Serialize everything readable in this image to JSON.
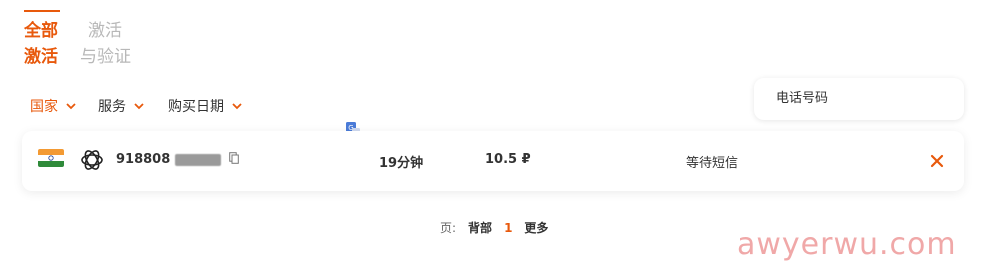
{
  "tabs": [
    {
      "label_line1": "全部",
      "label_line2": "激活",
      "active": true
    },
    {
      "label_line1": "激活",
      "label_line2": "与验证",
      "active": false
    }
  ],
  "filters": {
    "country": "国家",
    "service": "服务",
    "date": "购买日期"
  },
  "search": {
    "placeholder": "电话号码"
  },
  "rows": [
    {
      "flag": "india-flag",
      "service_icon": "openai-icon",
      "phone": "918808",
      "time": "19分钟",
      "price": "10.5 ₽",
      "status": "等待短信"
    }
  ],
  "pagination": {
    "label": "页:",
    "first": "背部",
    "current": "1",
    "more": "更多"
  },
  "colors": {
    "accent": "#e8590c",
    "watermark": "#f0a8a8"
  },
  "watermark": "awyerwu.com"
}
